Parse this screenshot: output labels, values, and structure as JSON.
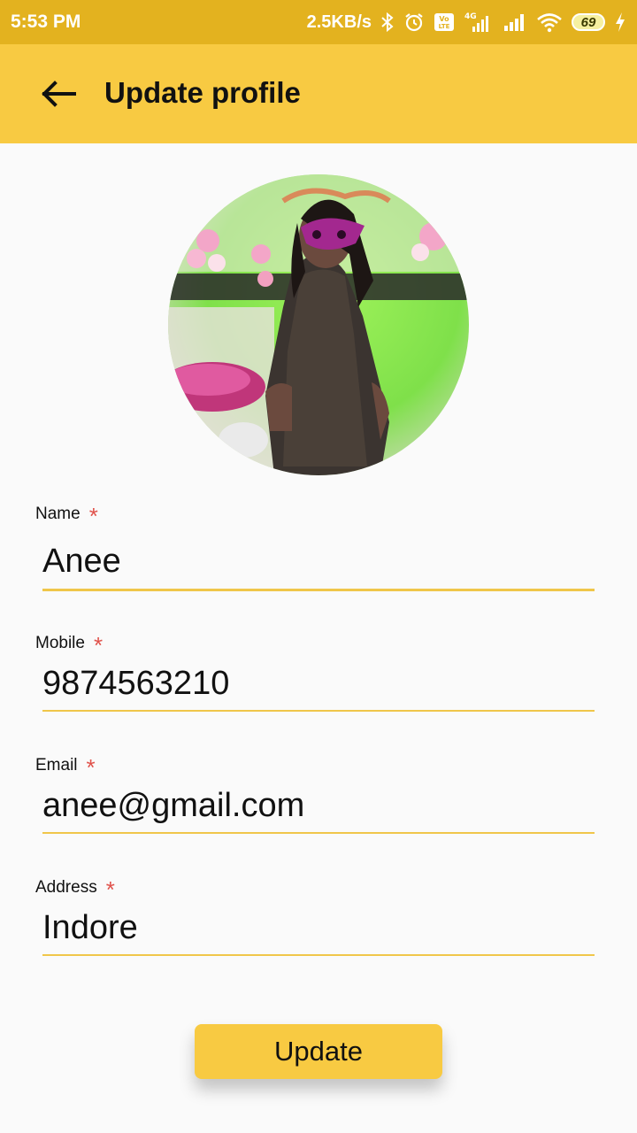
{
  "status_bar": {
    "time": "5:53 PM",
    "speed": "2.5KB/s",
    "battery": "69",
    "icons": [
      "bluetooth-icon",
      "alarm-icon",
      "volte-icon",
      "signal-4g-icon",
      "signal-icon",
      "wifi-icon",
      "battery-icon",
      "charging-icon"
    ]
  },
  "app_bar": {
    "title": "Update profile",
    "back_icon": "arrow-back-icon"
  },
  "colors": {
    "accent": "#f8ca42",
    "status_bar": "#e3b21f",
    "required_star": "#e0524b",
    "underline": "#f0c64a"
  },
  "form": {
    "required_mark": "*",
    "name": {
      "label": "Name",
      "value": "Anee"
    },
    "mobile": {
      "label": "Mobile",
      "value": "9874563210"
    },
    "email": {
      "label": "Email",
      "value": "anee@gmail.com"
    },
    "address": {
      "label": "Address",
      "value": "Indore"
    }
  },
  "update_button": {
    "label": "Update"
  }
}
